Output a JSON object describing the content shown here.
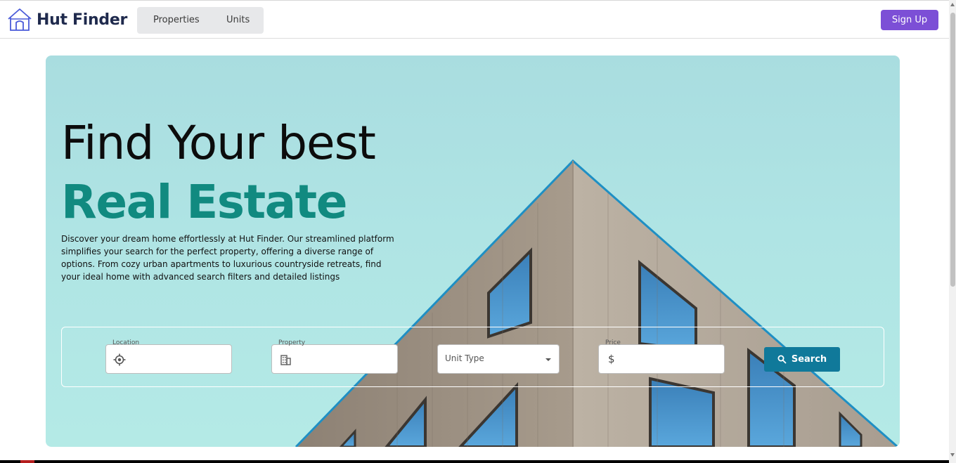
{
  "header": {
    "brand": "Hut Finder",
    "nav": {
      "properties": "Properties",
      "units": "Units"
    },
    "signup_label": "Sign Up"
  },
  "hero": {
    "title_line1": "Find Your best",
    "title_line2": "Real Estate",
    "description": "Discover your dream home effortlessly at Hut Finder. Our streamlined platform simplifies your search for the perfect property, offering a diverse range of options. From cozy urban apartments to luxurious countryside retreats, find your ideal home with advanced search filters and detailed listings"
  },
  "search": {
    "location_label": "Location",
    "property_label": "Property",
    "unit_type_placeholder": "Unit Type",
    "price_label": "Price",
    "price_symbol": "$",
    "button_label": "Search"
  },
  "colors": {
    "brand_text": "#1f2a4d",
    "accent_teal": "#118a80",
    "signup_purple": "#7c4fd6",
    "search_button": "#10799a"
  },
  "icons": {
    "logo": "house-icon",
    "location": "crosshair-location-icon",
    "property": "building-icon",
    "unit_type": "chevron-down-icon",
    "search": "magnifier-icon"
  }
}
